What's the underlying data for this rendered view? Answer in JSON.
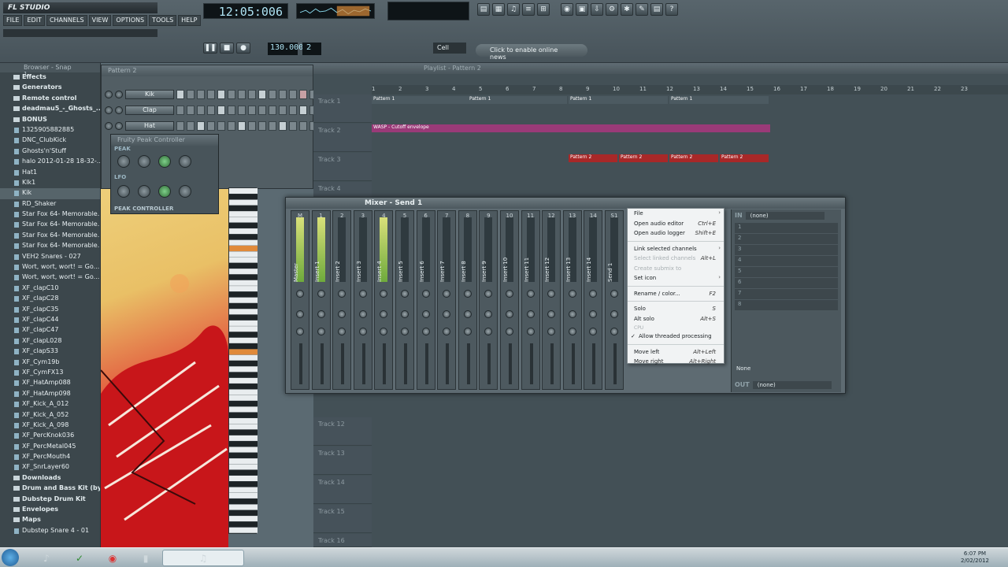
{
  "app": {
    "logo": "FL STUDIO",
    "menu": [
      "FILE",
      "EDIT",
      "CHANNELS",
      "VIEW",
      "OPTIONS",
      "TOOLS",
      "HELP"
    ],
    "time": "12:05:006",
    "tempo": "130.000",
    "pattern_num": "2",
    "snap": "Cell",
    "news": "Click to enable online news"
  },
  "browser": {
    "title": "Browser - Snap 1",
    "items": [
      {
        "label": "Effects",
        "kind": "folder"
      },
      {
        "label": "Generators",
        "kind": "folder"
      },
      {
        "label": "Remote control",
        "kind": "folder"
      },
      {
        "label": "deadmau5_-_Ghosts_...",
        "kind": "folder"
      },
      {
        "label": "BONUS",
        "kind": "folder"
      },
      {
        "label": "1325905882885",
        "kind": "file"
      },
      {
        "label": "DNC_ClubKick",
        "kind": "file"
      },
      {
        "label": "Ghosts'n'Stuff",
        "kind": "file"
      },
      {
        "label": "halo 2012-01-28 18-32-...",
        "kind": "file"
      },
      {
        "label": "Hat1",
        "kind": "file"
      },
      {
        "label": "Klk1",
        "kind": "file"
      },
      {
        "label": "Kik",
        "kind": "file"
      },
      {
        "label": "RD_Shaker",
        "kind": "file"
      },
      {
        "label": "Star Fox 64- Memorable...",
        "kind": "file"
      },
      {
        "label": "Star Fox 64- Memorable...",
        "kind": "file"
      },
      {
        "label": "Star Fox 64- Memorable...",
        "kind": "file"
      },
      {
        "label": "Star Fox 64- Memorable...",
        "kind": "file"
      },
      {
        "label": "VEH2 Snares - 027",
        "kind": "file"
      },
      {
        "label": "Wort, wort, wort! = Go...",
        "kind": "file"
      },
      {
        "label": "Wort, wort, wort! = Go...",
        "kind": "file"
      },
      {
        "label": "XF_clapC10",
        "kind": "file"
      },
      {
        "label": "XF_clapC28",
        "kind": "file"
      },
      {
        "label": "XF_clapC35",
        "kind": "file"
      },
      {
        "label": "XF_clapC44",
        "kind": "file"
      },
      {
        "label": "XF_clapC47",
        "kind": "file"
      },
      {
        "label": "XF_clapL028",
        "kind": "file"
      },
      {
        "label": "XF_clapS33",
        "kind": "file"
      },
      {
        "label": "XF_Cym19b",
        "kind": "file"
      },
      {
        "label": "XF_CymFX13",
        "kind": "file"
      },
      {
        "label": "XF_HatAmp088",
        "kind": "file"
      },
      {
        "label": "XF_HatAmp098",
        "kind": "file"
      },
      {
        "label": "XF_Kick_A_012",
        "kind": "file"
      },
      {
        "label": "XF_Kick_A_052",
        "kind": "file"
      },
      {
        "label": "XF_Kick_A_098",
        "kind": "file"
      },
      {
        "label": "XF_PercKnok036",
        "kind": "file"
      },
      {
        "label": "XF_PercMetal045",
        "kind": "file"
      },
      {
        "label": "XF_PercMouth4",
        "kind": "file"
      },
      {
        "label": "XF_SnrLayer60",
        "kind": "file"
      },
      {
        "label": "Downloads",
        "kind": "folder"
      },
      {
        "label": "Drum and Bass Kit (by ...",
        "kind": "folder"
      },
      {
        "label": "Dubstep Drum Kit",
        "kind": "folder"
      },
      {
        "label": "Envelopes",
        "kind": "folder"
      },
      {
        "label": "Maps",
        "kind": "folder"
      },
      {
        "label": "Dubstep Snare 4 - 01",
        "kind": "file"
      }
    ]
  },
  "stepseq": {
    "title": "Pattern 2",
    "channels": [
      "Kik",
      "Clap",
      "Hat"
    ]
  },
  "peak": {
    "title": "Fruity Peak Controller",
    "label_peak": "PEAK",
    "label_lfo": "LFO",
    "footer": "PEAK CONTROLLER"
  },
  "playlist": {
    "title": "Playlist - Pattern 2",
    "ruler": [
      "1",
      "2",
      "3",
      "4",
      "5",
      "6",
      "7",
      "8",
      "9",
      "10",
      "11",
      "12",
      "13",
      "14",
      "15",
      "16",
      "17",
      "18",
      "19",
      "20",
      "21",
      "22",
      "23"
    ],
    "tracks": [
      "Track 1",
      "Track 2",
      "Track 3",
      "Track 4",
      "Track 12",
      "Track 13",
      "Track 14",
      "Track 15",
      "Track 16"
    ],
    "clips": {
      "pattern1": "Pattern 1",
      "wasp": "WASP - Cutoff envelope",
      "pattern2": "Pattern 2"
    }
  },
  "mixer": {
    "title": "Mixer - Send 1",
    "strips": [
      {
        "num": "M",
        "label": "Master"
      },
      {
        "num": "1",
        "label": "Insert 1"
      },
      {
        "num": "2",
        "label": "Insert 2"
      },
      {
        "num": "3",
        "label": "Insert 3"
      },
      {
        "num": "4",
        "label": "Insert 4"
      },
      {
        "num": "5",
        "label": "Insert 5"
      },
      {
        "num": "6",
        "label": "Insert 6"
      },
      {
        "num": "7",
        "label": "Insert 7"
      },
      {
        "num": "8",
        "label": "Insert 8"
      },
      {
        "num": "9",
        "label": "Insert 9"
      },
      {
        "num": "10",
        "label": "Insert 10"
      },
      {
        "num": "11",
        "label": "Insert 11"
      },
      {
        "num": "12",
        "label": "Insert 12"
      },
      {
        "num": "13",
        "label": "Insert 13"
      },
      {
        "num": "14",
        "label": "Insert 14"
      },
      {
        "num": "S1",
        "label": "Send 1"
      }
    ],
    "in_label": "IN",
    "in_value": "(none)",
    "slots": [
      "1",
      "2",
      "3",
      "4",
      "5",
      "6",
      "7",
      "8"
    ],
    "out_label": "OUT",
    "out_value": "(none)",
    "none_label": "None"
  },
  "context_menu": {
    "items": [
      {
        "label": "File",
        "shortcut": "",
        "type": "sub"
      },
      {
        "label": "Open audio editor",
        "shortcut": "Ctrl+E",
        "type": "item"
      },
      {
        "label": "Open audio logger",
        "shortcut": "Shift+E",
        "type": "item"
      },
      {
        "label": "",
        "shortcut": "",
        "type": "sep"
      },
      {
        "label": "Link selected channels",
        "shortcut": "",
        "type": "sub"
      },
      {
        "label": "Select linked channels",
        "shortcut": "Alt+L",
        "type": "dis"
      },
      {
        "label": "Create submix to",
        "shortcut": "",
        "type": "dis"
      },
      {
        "label": "Set icon",
        "shortcut": "",
        "type": "sub"
      },
      {
        "label": "",
        "shortcut": "",
        "type": "sep"
      },
      {
        "label": "Rename / color...",
        "shortcut": "F2",
        "type": "item"
      },
      {
        "label": "",
        "shortcut": "",
        "type": "sep"
      },
      {
        "label": "Solo",
        "shortcut": "S",
        "type": "item"
      },
      {
        "label": "Alt solo",
        "shortcut": "Alt+S",
        "type": "item"
      },
      {
        "label": "CPU",
        "shortcut": "",
        "type": "hdr"
      },
      {
        "label": "Allow threaded processing",
        "shortcut": "",
        "type": "chk"
      },
      {
        "label": "",
        "shortcut": "",
        "type": "sep"
      },
      {
        "label": "Move left",
        "shortcut": "Alt+Left",
        "type": "item"
      },
      {
        "label": "Move right",
        "shortcut": "Alt+Right",
        "type": "item"
      }
    ]
  },
  "taskbar": {
    "clock_time": "6:07 PM",
    "clock_date": "2/02/2012"
  }
}
